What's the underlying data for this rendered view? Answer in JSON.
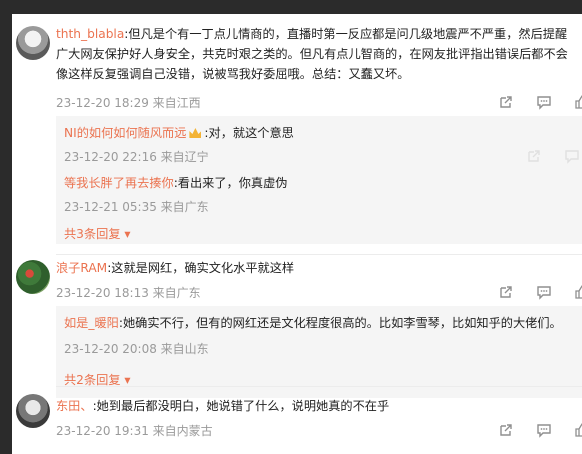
{
  "comments": [
    {
      "user": "thth_blabla",
      "line1": ":但凡是个有一丁点儿情商的，直播时第一反应都是问几级地震严不严重，然后提醒",
      "line2": "广大网友保护好人身安全，共克时艰之类的。但凡有点儿智商的，在网友批评指出错误后都不会",
      "line3": "像这样反复强调自己没错，说被骂我好委屈哦。总结：又蠢又坏。",
      "meta": "23-12-20 18:29 来自江西",
      "replies": [
        {
          "user": "NI的如何如何随风而远",
          "text": ":对，就这个意思",
          "meta": "23-12-20 22:16 来自辽宁"
        },
        {
          "user": "等我长胖了再去揍你",
          "text": ":看出来了，你真虚伪",
          "meta": "23-12-21 05:35 来自广东"
        }
      ],
      "more": "共3条回复"
    },
    {
      "user": "浪子RAM",
      "line1": ":这就是网红，确实文化水平就这样",
      "meta": "23-12-20 18:13 来自广东",
      "replies": [
        {
          "user": "如是_暖阳",
          "text": ":她确实不行，但有的网红还是文化程度很高的。比如李雪琴，比如知乎的大佬们。",
          "meta": "23-12-20 20:08 来自山东"
        }
      ],
      "more": "共2条回复"
    },
    {
      "user": "东田、",
      "line1": ":她到最后都没明白，她说错了什么，说明她真的不在乎",
      "meta": "23-12-20 19:31 来自内蒙古"
    }
  ],
  "icons": {
    "share": "share-icon",
    "comment": "comment-icon",
    "like": "like-icon"
  },
  "colors": {
    "username": "#eb7350",
    "meta": "#9a9a9a",
    "background": "#2b2b2b"
  }
}
